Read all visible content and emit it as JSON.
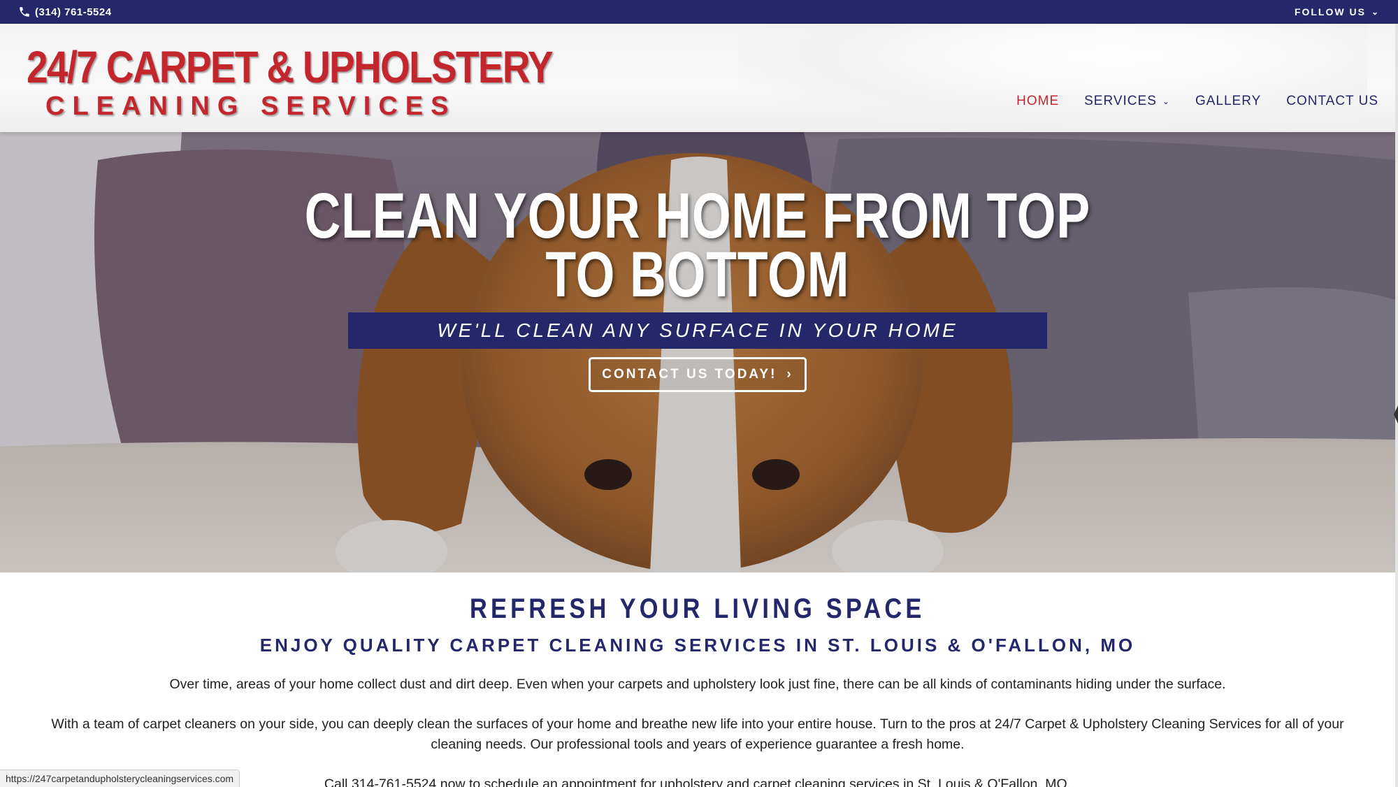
{
  "topbar": {
    "phone": "(314) 761-5524",
    "phone_icon": "phone-icon",
    "follow_label": "FOLLOW US",
    "follow_icon": "chevron-down-icon"
  },
  "logo": {
    "line1": "24/7 CARPET & UPHOLSTERY",
    "line2": "CLEANING SERVICES"
  },
  "nav": {
    "items": [
      {
        "label": "HOME",
        "active": true
      },
      {
        "label": "SERVICES",
        "has_dropdown": true
      },
      {
        "label": "GALLERY"
      },
      {
        "label": "CONTACT US"
      }
    ]
  },
  "hero": {
    "title_line1": "CLEAN YOUR HOME FROM TOP",
    "title_line2": "TO BOTTOM",
    "subtitle": "WE'LL CLEAN ANY SURFACE IN YOUR HOME",
    "button_label": "CONTACT US TODAY!",
    "button_icon": "chevron-right-icon"
  },
  "content": {
    "title": "REFRESH YOUR LIVING SPACE",
    "subtitle": "ENJOY QUALITY CARPET CLEANING SERVICES IN ST. LOUIS & O'FALLON, MO",
    "para1": "Over time, areas of your home collect dust and dirt deep. Even when your carpets and upholstery look just fine, there can be all kinds of contaminants hiding under the surface.",
    "para2": "With a team of carpet cleaners on your side, you can deeply clean the surfaces of your home and breathe new life into your entire house. Turn to the pros at 24/7 Carpet & Upholstery Cleaning Services for all of your cleaning needs. Our professional tools and years of experience guarantee a fresh home.",
    "para3": "Call 314-761-5524 now to schedule an appointment for upholstery and carpet cleaning services in St. Louis & O'Fallon, MO."
  },
  "statusbar": {
    "url": "https://247carpetandupholsterycleaningservices.com"
  },
  "colors": {
    "navy": "#24286a",
    "brand_red": "#c4262e",
    "white": "#ffffff"
  }
}
